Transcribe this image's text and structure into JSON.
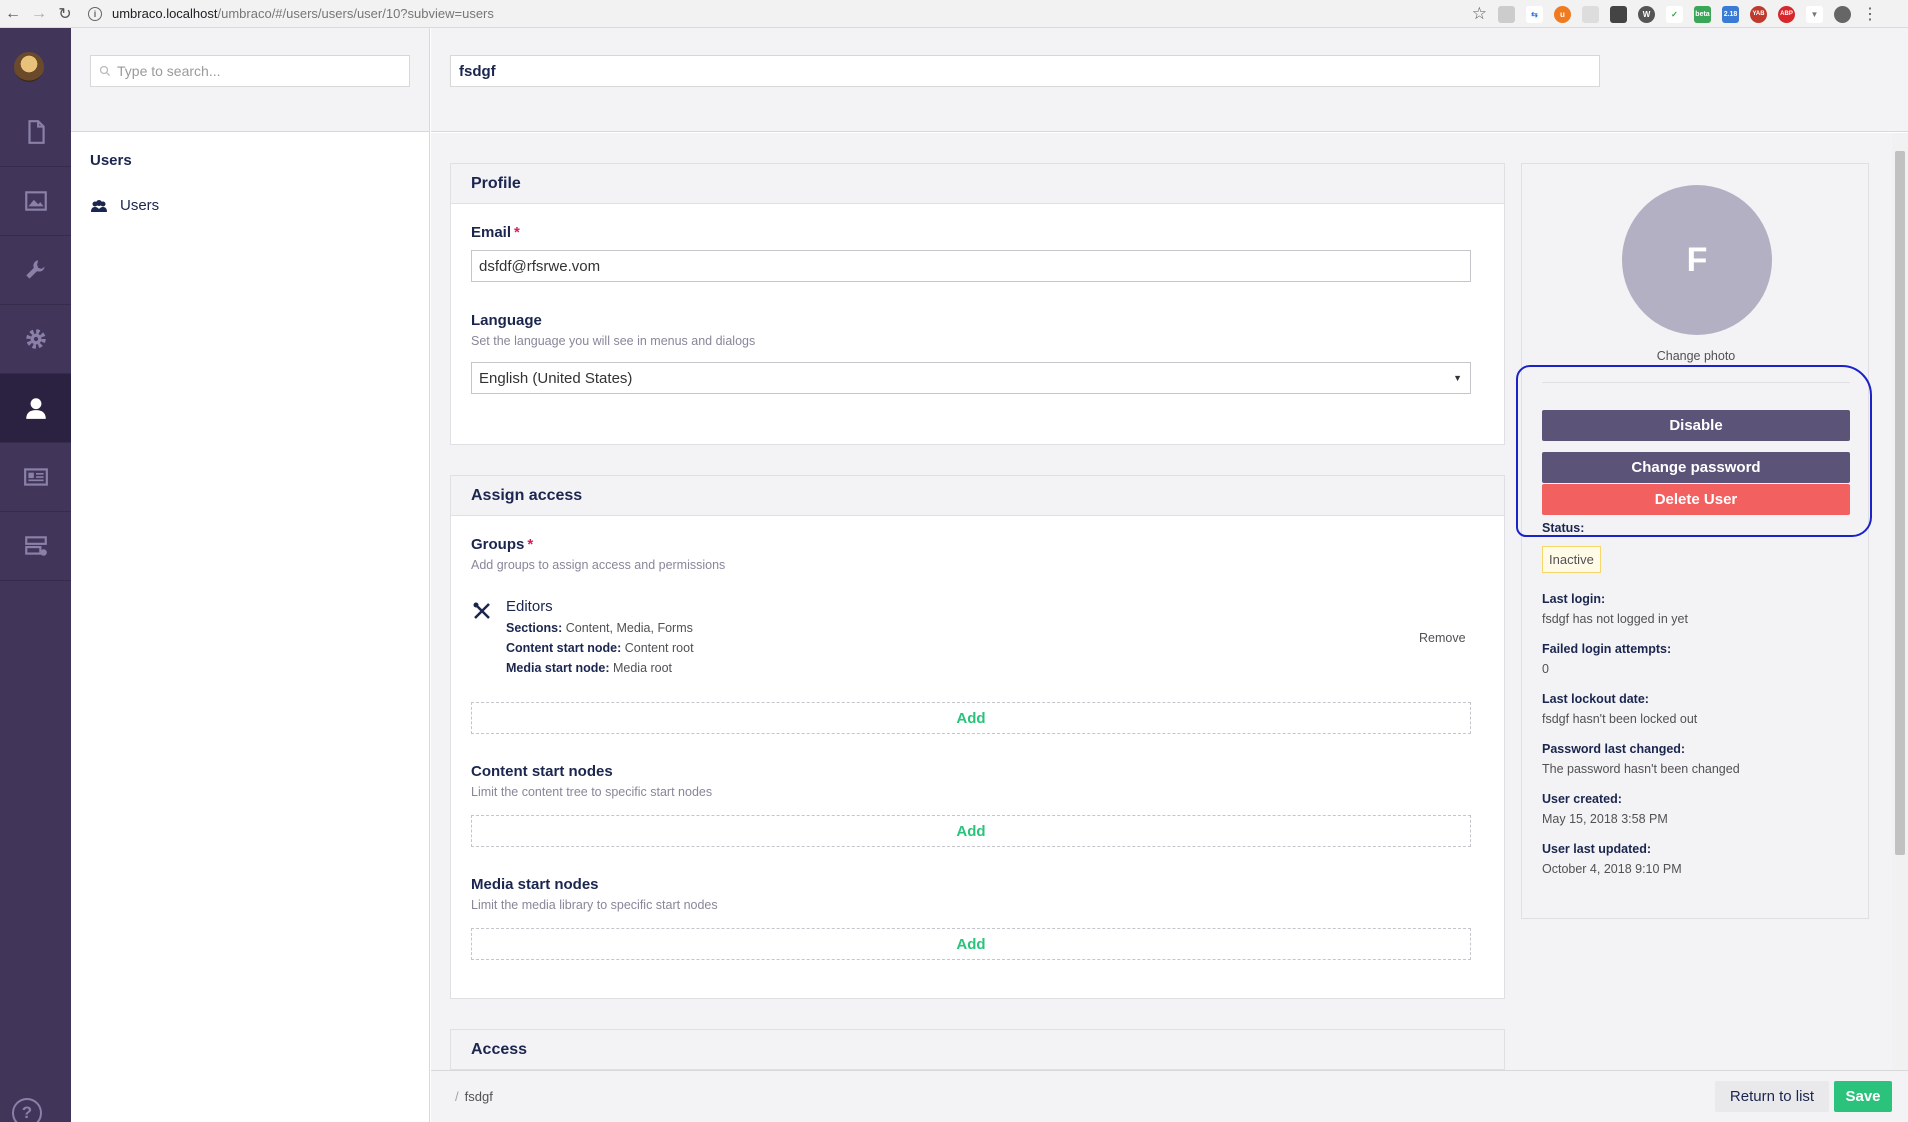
{
  "browser": {
    "url_host": "umbraco.localhost",
    "url_path": "/umbraco/#/users/users/user/10?subview=users",
    "info_glyph": "i",
    "ext_beta": "beta",
    "ext_218": "2.18",
    "ext_yab": "YAB",
    "ext_abp": "ABP"
  },
  "sidebar": {
    "sections": [
      {
        "name": "content",
        "icon": "document-icon"
      },
      {
        "name": "media",
        "icon": "image-icon"
      },
      {
        "name": "settings",
        "icon": "wrench-icon"
      },
      {
        "name": "developer",
        "icon": "gear-icon"
      },
      {
        "name": "users",
        "icon": "user-icon",
        "active": true
      },
      {
        "name": "members",
        "icon": "id-card-icon"
      },
      {
        "name": "forms",
        "icon": "forms-icon"
      }
    ],
    "help_glyph": "?"
  },
  "tree": {
    "search_placeholder": "Type to search...",
    "title": "Users",
    "item_label": "Users"
  },
  "editor": {
    "name_value": "fsdgf",
    "profile": {
      "title": "Profile",
      "email_label": "Email",
      "email_value": "dsfdf@rfsrwe.vom",
      "language_label": "Language",
      "language_desc": "Set the language you will see in menus and dialogs",
      "language_value": "English (United States)",
      "select_arrow": "▼"
    },
    "assign": {
      "title": "Assign access",
      "groups_label": "Groups",
      "groups_desc": "Add groups to assign access and permissions",
      "group_name": "Editors",
      "sections_key": "Sections:",
      "sections_val": " Content, Media, Forms",
      "content_start_key": "Content start node:",
      "content_start_val": " Content root",
      "media_start_key": "Media start node:",
      "media_start_val": " Media root",
      "remove_label": "Remove",
      "add_label": "Add",
      "content_nodes_label": "Content start nodes",
      "content_nodes_desc": "Limit the content tree to specific start nodes",
      "media_nodes_label": "Media start nodes",
      "media_nodes_desc": "Limit the media library to specific start nodes"
    },
    "access": {
      "title": "Access"
    },
    "required_mark": "*"
  },
  "user_panel": {
    "avatar_initial": "F",
    "change_photo": "Change photo",
    "disable_label": "Disable",
    "change_password_label": "Change password",
    "delete_label": "Delete User",
    "status_label": "Status:",
    "status_value": "Inactive",
    "last_login_label": "Last login:",
    "last_login_value": "fsdgf has not logged in yet",
    "failed_label": "Failed login attempts:",
    "failed_value": "0",
    "lockout_label": "Last lockout date:",
    "lockout_value": "fsdgf hasn't been locked out",
    "pw_changed_label": "Password last changed:",
    "pw_changed_value": "The password hasn't been changed",
    "created_label": "User created:",
    "created_value": "May 15, 2018 3:58 PM",
    "updated_label": "User last updated:",
    "updated_value": "October 4, 2018 9:10 PM",
    "accent_colors": {
      "dark": "#5c5478",
      "danger": "#f36060",
      "success": "#2bc37c"
    }
  },
  "footer": {
    "crumb_sep": "/",
    "crumb": "fsdgf",
    "return_label": "Return to list",
    "save_label": "Save"
  }
}
